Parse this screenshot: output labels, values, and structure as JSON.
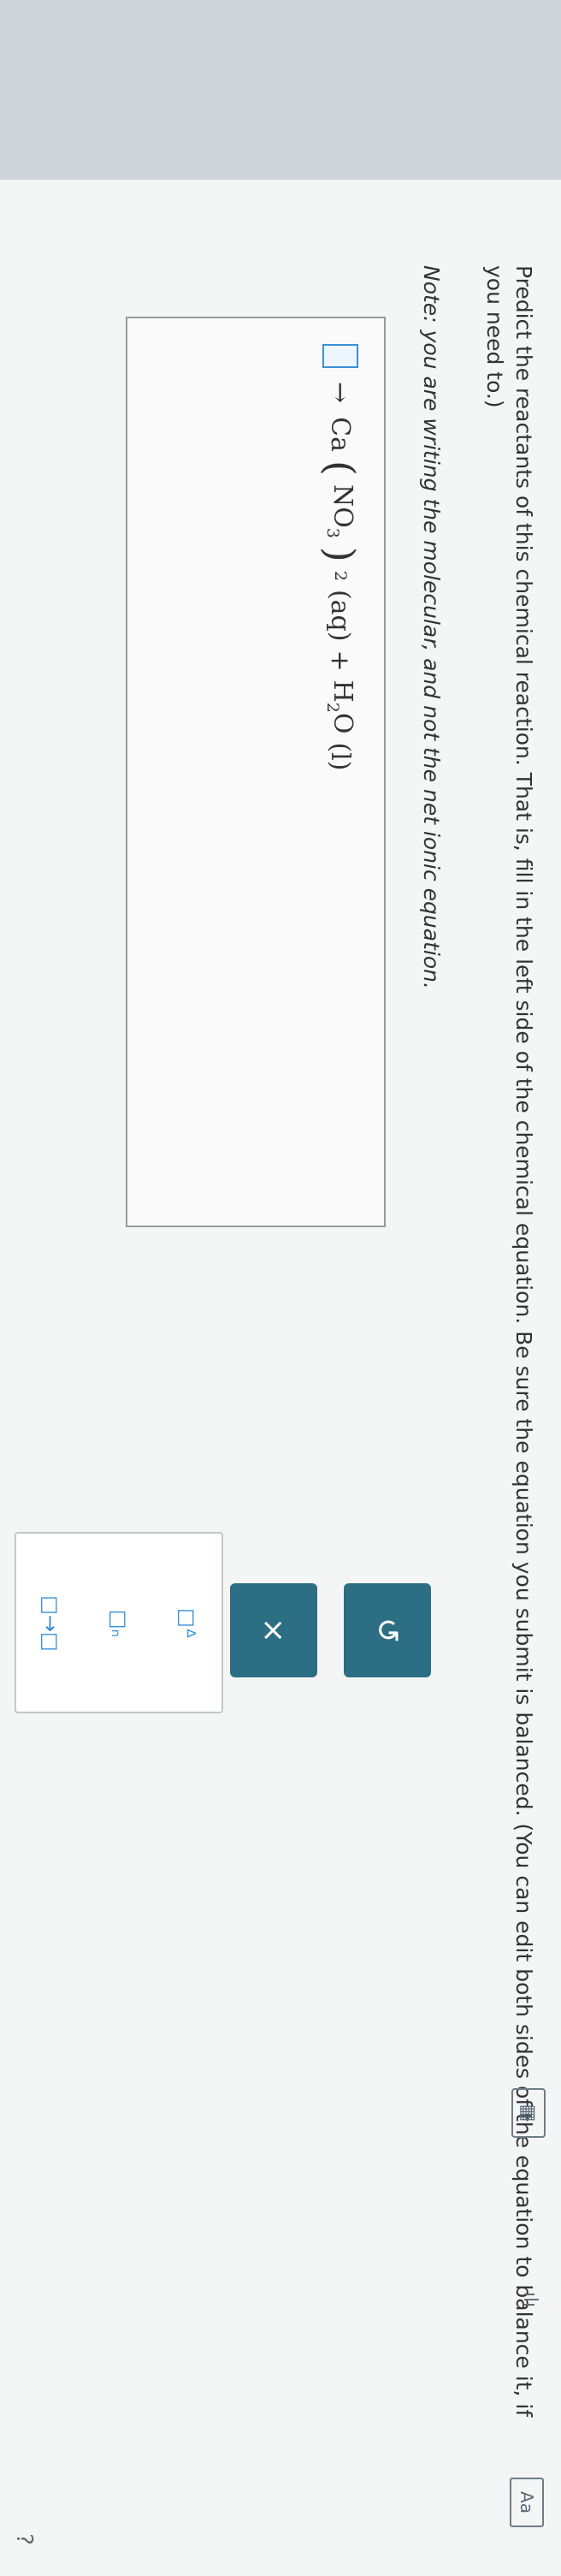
{
  "question": {
    "instructions": "Predict the reactants of this chemical reaction. That is, fill in the left side of the chemical equation. Be sure the equation you submit is balanced. (You can edit both sides of the equation to balance it, if you need to.)",
    "note_label": "Note:",
    "note_text": "you are writing the molecular, and not the net ionic equation."
  },
  "equation": {
    "arrow": "→",
    "calcium": "Ca",
    "nitrate_group": "NO",
    "nitrate_o_sub": "3",
    "nitrate_count": "2",
    "state_aq": "(aq)",
    "plus": "+",
    "water_h": "H",
    "water_h_sub": "2",
    "water_o": "O",
    "state_l": "(l)"
  },
  "toolbar": {
    "superscript_tool": "□ᐞ",
    "subscript_tool": "□ₙ",
    "arrow_tool": "□→□",
    "clear_button": "×",
    "undo_button": "↺"
  },
  "side_icons": {
    "periodic_table": "▦",
    "chart_tool": "ılı",
    "text_size": "Aa",
    "help": "?"
  }
}
